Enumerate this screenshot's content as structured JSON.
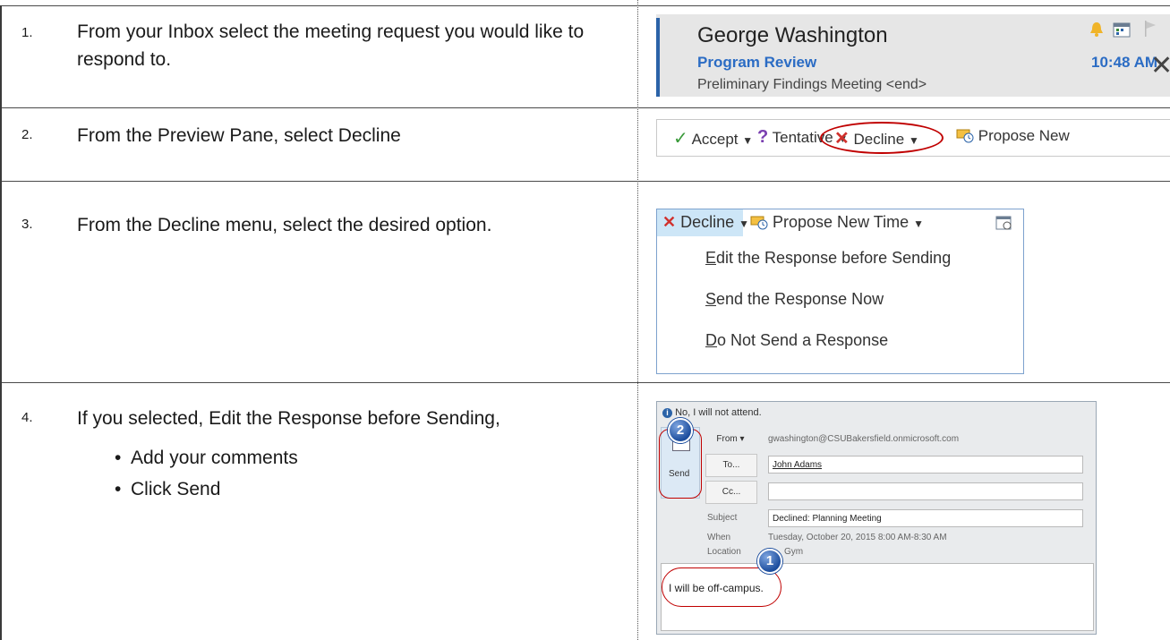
{
  "steps": [
    {
      "number": "1.",
      "text": "From your Inbox select the meeting request you would like to respond to."
    },
    {
      "number": "2.",
      "text": "From the Preview Pane, select Decline"
    },
    {
      "number": "3.",
      "text": "From the Decline menu, select the desired option."
    },
    {
      "number": "4.",
      "text": "If you selected, Edit the Response before Sending,",
      "bullets": [
        "Add your comments",
        "Click Send"
      ]
    }
  ],
  "inbox_item": {
    "sender": "George Washington",
    "subject": "Program Review",
    "preview": "Preliminary Findings Meeting <end>",
    "time": "10:48 AM",
    "accent_color": "#2b6cc4",
    "icons": [
      "bell-icon",
      "calendar-icon",
      "flag-icon",
      "close-icon"
    ]
  },
  "response_bar": {
    "accept": "Accept",
    "tentative": "Tentative",
    "decline": "Decline",
    "propose": "Propose New"
  },
  "decline_menu": {
    "decline": "Decline",
    "propose": "Propose New Time",
    "options": [
      {
        "key": "E",
        "rest": "dit the Response before Sending"
      },
      {
        "key": "S",
        "rest": "end the Response Now"
      },
      {
        "key": "D",
        "rest": "o Not Send a Response"
      }
    ]
  },
  "compose": {
    "info": "No, I will not attend.",
    "send_label": "Send",
    "from_label": "From",
    "from_value": "gwashington@CSUBakersfield.onmicrosoft.com",
    "to_label": "To...",
    "to_value": "John Adams",
    "cc_label": "Cc...",
    "cc_value": "",
    "subject_label": "Subject",
    "subject_value": "Declined: Planning Meeting",
    "when_label": "When",
    "when_value": "Tuesday, October 20, 2015 8:00 AM-8:30 AM",
    "location_label": "Location",
    "location_value": "Gym",
    "body_text": "I will be off-campus.",
    "badge_1": "1",
    "badge_2": "2",
    "highlight_color": "#c00000"
  }
}
